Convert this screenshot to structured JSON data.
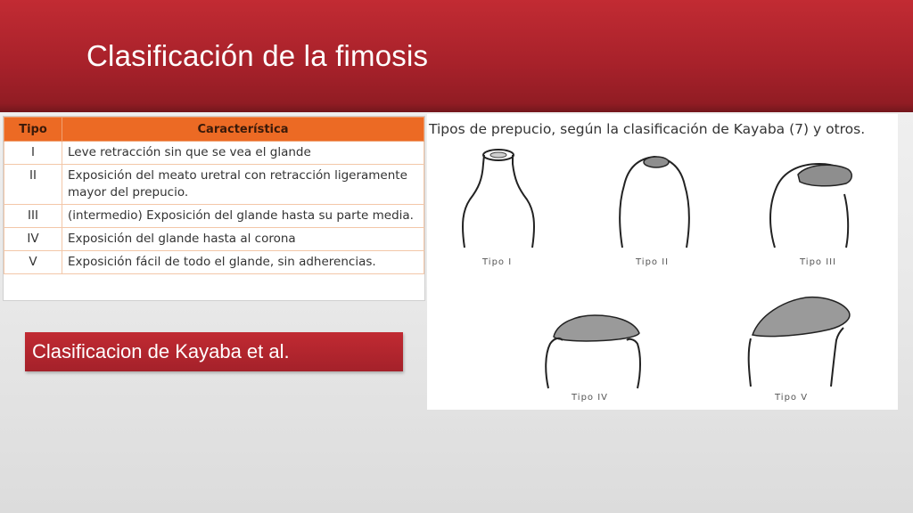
{
  "slide": {
    "title": "Clasificación de la fimosis"
  },
  "table": {
    "headers": {
      "tipo": "Tipo",
      "caracteristica": "Característica"
    },
    "rows": [
      {
        "tipo": "I",
        "caracteristica": "Leve retracción sin que se vea el glande"
      },
      {
        "tipo": "II",
        "caracteristica": "Exposición del meato uretral con retracción ligeramente mayor del prepucio."
      },
      {
        "tipo": "III",
        "caracteristica": "(intermedio) Exposición del glande hasta su parte media."
      },
      {
        "tipo": "IV",
        "caracteristica": "Exposición del glande hasta al corona"
      },
      {
        "tipo": "V",
        "caracteristica": "Exposición fácil de todo el glande, sin adherencias."
      }
    ]
  },
  "callout": {
    "text": "Clasificacion de Kayaba et al."
  },
  "figure": {
    "caption": "Tipos de prepucio, según la clasificación de Kayaba (7) y otros.",
    "labels": [
      "Tipo I",
      "Tipo II",
      "Tipo III",
      "Tipo IV",
      "Tipo V"
    ]
  },
  "colors": {
    "header_red": "#b3252d",
    "table_header_orange": "#ec6a24",
    "glans_gray": "#9a9a9a"
  }
}
